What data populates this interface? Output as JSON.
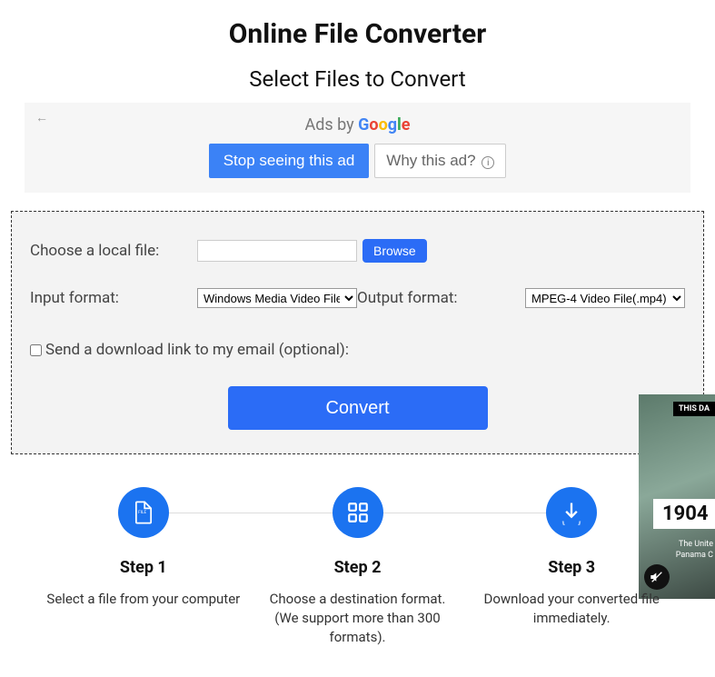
{
  "page": {
    "title": "Online File Converter",
    "subtitle": "Select Files to Convert"
  },
  "ad": {
    "adsby": "Ads by ",
    "stop": "Stop seeing this ad",
    "why": "Why this ad?"
  },
  "form": {
    "chooseLabel": "Choose a local file:",
    "browse": "Browse",
    "inputFormatLabel": "Input format:",
    "inputFormatValue": "Windows Media Video File(.wmv)",
    "outputFormatLabel": "Output format:",
    "outputFormatValue": "MPEG-4 Video File(.mp4)",
    "emailLabel": "Send a download link to my email (optional):",
    "convert": "Convert"
  },
  "steps": [
    {
      "title": "Step 1",
      "desc": "Select a file from your computer"
    },
    {
      "title": "Step 2",
      "desc": "Choose a destination format. (We support more than 300 formats)."
    },
    {
      "title": "Step 3",
      "desc": "Download your converted file immediately."
    }
  ],
  "video": {
    "tag": "THIS DA",
    "year": "1904",
    "line1": "The Unite",
    "line2": "Panama C"
  }
}
